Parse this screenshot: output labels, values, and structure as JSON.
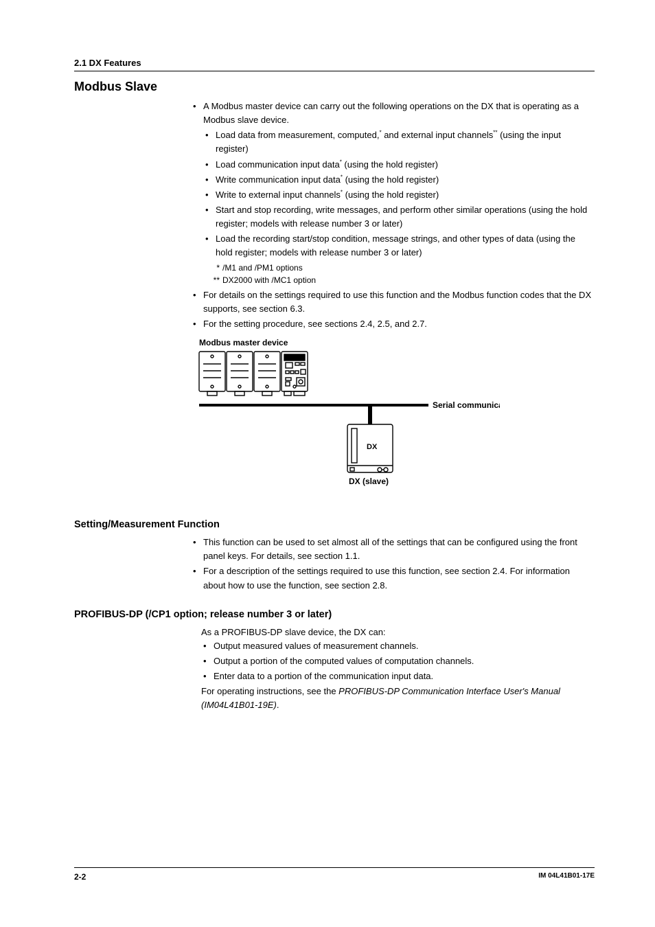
{
  "header": {
    "section": "2.1  DX Features"
  },
  "modbus": {
    "heading": "Modbus Slave",
    "intro": "A Modbus master device can carry out the following operations on the DX that is operating as a Modbus slave device.",
    "sub": [
      {
        "pre": "Load data from measurement, computed,",
        "sup1": "*",
        "mid": " and external input channels",
        "sup2": "**",
        "post": " (using the input register)"
      },
      {
        "pre": "Load communication input data",
        "sup1": "*",
        "post": " (using the hold register)"
      },
      {
        "pre": "Write communication input data",
        "sup1": "*",
        "post": " (using the hold register)"
      },
      {
        "pre": "Write to external input channels",
        "sup1": "*",
        "post": " (using the hold register)"
      },
      {
        "pre": "Start and stop recording, write messages, and perform other similar operations (using the hold register; models with release number 3 or later)"
      },
      {
        "pre": "Load the recording start/stop condition, message strings, and other types of data (using the hold register; models with release number 3 or later)"
      }
    ],
    "footnotes": [
      {
        "mark": "*",
        "text": "/M1 and /PM1 options"
      },
      {
        "mark": "**",
        "text": "DX2000 with /MC1 option"
      }
    ],
    "after": [
      "For details on the settings required to use this function and the Modbus function codes that the DX supports, see section 6.3.",
      "For the setting procedure, see sections 2.4, 2.5, and 2.7."
    ],
    "dia": {
      "master": "Modbus master device",
      "serial": "Serial communication",
      "dxslave": "DX (slave)",
      "dx": "DX"
    }
  },
  "setting": {
    "heading": "Setting/Measurement Function",
    "items": [
      "This function can be used to set almost all of the settings that can be configured using the front panel keys. For details, see section 1.1.",
      "For a description of the settings required to use this function, see section 2.4. For information about how to use the function, see section 2.8."
    ]
  },
  "profibus": {
    "heading": "PROFIBUS-DP (/CP1 option; release number 3 or later)",
    "intro": "As a PROFIBUS-DP slave device, the DX can:",
    "items": [
      "Output measured values of measurement channels.",
      "Output a portion of the computed values of computation channels.",
      "Enter data to a portion of the communication input data."
    ],
    "outro_pre": "For operating instructions, see the ",
    "outro_italic": "PROFIBUS-DP Communication Interface User's Manual (IM04L41B01-19E)",
    "outro_post": "."
  },
  "footer": {
    "page": "2-2",
    "doc": "IM 04L41B01-17E"
  }
}
